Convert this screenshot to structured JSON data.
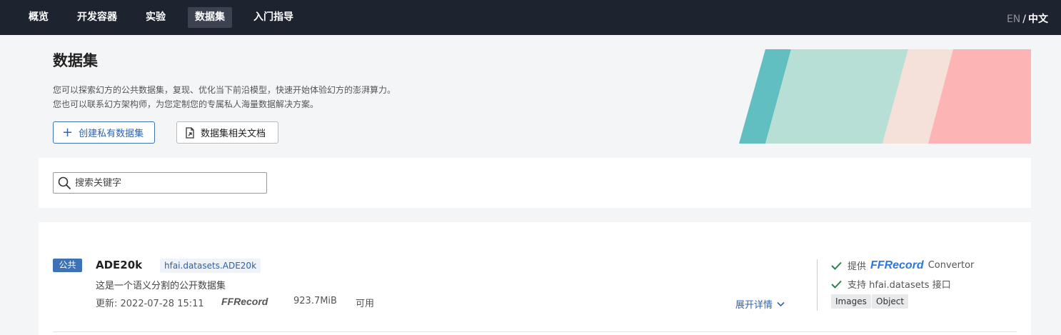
{
  "nav": {
    "items": [
      {
        "label": "概览"
      },
      {
        "label": "开发容器"
      },
      {
        "label": "实验"
      },
      {
        "label": "数据集"
      },
      {
        "label": "入门指导"
      }
    ],
    "active": "数据集",
    "lang": {
      "en": "EN",
      "sep": "/",
      "zh": "中文"
    }
  },
  "header": {
    "title": "数据集",
    "desc_line1": "您可以探索幻方的公共数据集，复现、优化当下前沿模型，快速开始体验幻方的澎湃算力。",
    "desc_line2": "您也可以联系幻方架构师，为您定制您的专属私人海量数据解决方案。",
    "create_button": "创建私有数据集",
    "docs_button": "数据集相关文档"
  },
  "banner": {
    "colors": [
      "#62bfc1",
      "#b8dfd6",
      "#f5e1d9",
      "#fcb5b4"
    ]
  },
  "search": {
    "placeholder": "搜索关键字"
  },
  "dataset": {
    "badge": "公共",
    "name": "ADE20k",
    "module": "hfai.datasets.ADE20k",
    "description": "这是一个语义分割的公开数据集",
    "updated": "更新: 2022-07-28 15:11",
    "format_logo": "FFRecord",
    "size": "923.7MiB",
    "status": "可用",
    "expand_label": "展开详情",
    "features": {
      "provide_prefix": "提供",
      "provide_logo": "FFRecord",
      "provide_suffix": "Convertor",
      "support_text": "支持 hfai.datasets 接口"
    },
    "tags": [
      "Images",
      "Object"
    ]
  },
  "colors": {
    "nav_bg": "#1e2330",
    "accent": "#3d72b6",
    "check": "#2e7d4f",
    "ffrecord_blue": "#2f77d8"
  }
}
